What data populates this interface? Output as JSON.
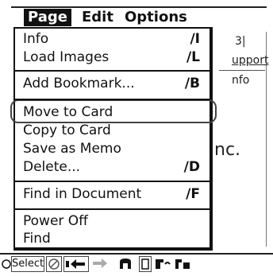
{
  "menubar": {
    "titles": [
      "Page",
      "Edit",
      "Options"
    ],
    "active": "Page"
  },
  "menu": {
    "items": [
      {
        "label": "Info",
        "shortcut": "∕I"
      },
      {
        "label": "Load Images",
        "shortcut": "∕L"
      },
      {
        "label": "Add Bookmark...",
        "shortcut": "∕B"
      },
      {
        "label": "Move to Card",
        "shortcut": ""
      },
      {
        "label": "Copy to Card",
        "shortcut": ""
      },
      {
        "label": "Save as Memo",
        "shortcut": ""
      },
      {
        "label": "Delete...",
        "shortcut": "∕D"
      },
      {
        "label": "Find in Document",
        "shortcut": "∕F"
      },
      {
        "label": "Power Off",
        "shortcut": ""
      },
      {
        "label": "Find",
        "shortcut": ""
      }
    ]
  },
  "background": {
    "line_a": "3|",
    "line_b": "upport",
    "line_c": "nfo",
    "line_d": "nc."
  },
  "toolbar": {
    "select_label": "Select",
    "icons": [
      "circle-icon",
      "no-entry-icon",
      "back-arrow-icon",
      "forward-arrow-icon",
      "home-icon",
      "page-icon",
      "bookmark-icon",
      "history-icon"
    ]
  }
}
